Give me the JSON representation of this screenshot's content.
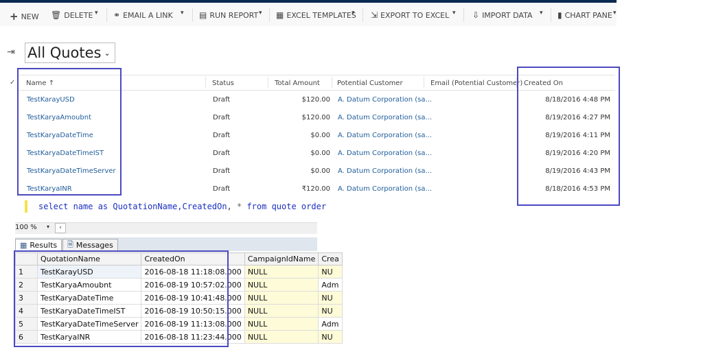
{
  "toolbar": {
    "new": "NEW",
    "delete": "DELETE",
    "email_link": "EMAIL A LINK",
    "run_report": "RUN REPORT",
    "excel_templates": "EXCEL TEMPLATES",
    "export_excel": "EXPORT TO EXCEL",
    "import_data": "IMPORT DATA",
    "chart_pane": "CHART PANE"
  },
  "view": {
    "title": "All Quotes",
    "dropdown_glyph": "⌄"
  },
  "grid": {
    "headers": {
      "name": "Name",
      "sort_glyph": "↑",
      "status": "Status",
      "total_amount": "Total Amount",
      "potential_customer": "Potential Customer",
      "email": "Email (Potential Customer)",
      "created_on": "Created On"
    },
    "rows": [
      {
        "name": "TestKarayUSD",
        "status": "Draft",
        "amount": "$120.00",
        "customer": "A. Datum Corporation (sa...",
        "created": "8/18/2016 4:48 PM"
      },
      {
        "name": "TestKaryaAmoubnt",
        "status": "Draft",
        "amount": "$120.00",
        "customer": "A. Datum Corporation (sa...",
        "created": "8/19/2016 4:27 PM"
      },
      {
        "name": "TestKaryaDateTime",
        "status": "Draft",
        "amount": "$0.00",
        "customer": "A. Datum Corporation (sa...",
        "created": "8/19/2016 4:11 PM"
      },
      {
        "name": "TestKaryaDateTimeIST",
        "status": "Draft",
        "amount": "$0.00",
        "customer": "A. Datum Corporation (sa...",
        "created": "8/19/2016 4:20 PM"
      },
      {
        "name": "TestKaryaDateTimeServer",
        "status": "Draft",
        "amount": "$0.00",
        "customer": "A. Datum Corporation (sa...",
        "created": "8/19/2016 4:43 PM"
      },
      {
        "name": "TestKaryaINR",
        "status": "Draft",
        "amount": "₹120.00",
        "customer": "A. Datum Corporation (sa...",
        "created": "8/18/2016 4:53 PM"
      }
    ]
  },
  "sql": {
    "part1": "select name as ",
    "part2": "QuotationName,CreatedOn",
    "part3": ", ",
    "part4": "* ",
    "part5": "from quote order"
  },
  "editor": {
    "zoom": "100 %"
  },
  "results_tabs": {
    "results": "Results",
    "messages": "Messages"
  },
  "results": {
    "headers": [
      "",
      "QuotationName",
      "CreatedOn",
      "CampaignIdName",
      "Crea"
    ],
    "rows": [
      {
        "n": "1",
        "name": "TestKarayUSD",
        "created": "2016-08-18 11:18:08.000",
        "campaign": "NULL",
        "crea": "NU"
      },
      {
        "n": "2",
        "name": "TestKaryaAmoubnt",
        "created": "2016-08-19 10:57:02.000",
        "campaign": "NULL",
        "crea": "Adm"
      },
      {
        "n": "3",
        "name": "TestKaryaDateTime",
        "created": "2016-08-19 10:41:48.000",
        "campaign": "NULL",
        "crea": "NU"
      },
      {
        "n": "4",
        "name": "TestKaryaDateTimeIST",
        "created": "2016-08-19 10:50:15.000",
        "campaign": "NULL",
        "crea": "NU"
      },
      {
        "n": "5",
        "name": "TestKaryaDateTimeServer",
        "created": "2016-08-19 11:13:08.000",
        "campaign": "NULL",
        "crea": "Adm"
      },
      {
        "n": "6",
        "name": "TestKaryaINR",
        "created": "2016-08-18 11:23:44.000",
        "campaign": "NULL",
        "crea": "NU"
      }
    ]
  }
}
